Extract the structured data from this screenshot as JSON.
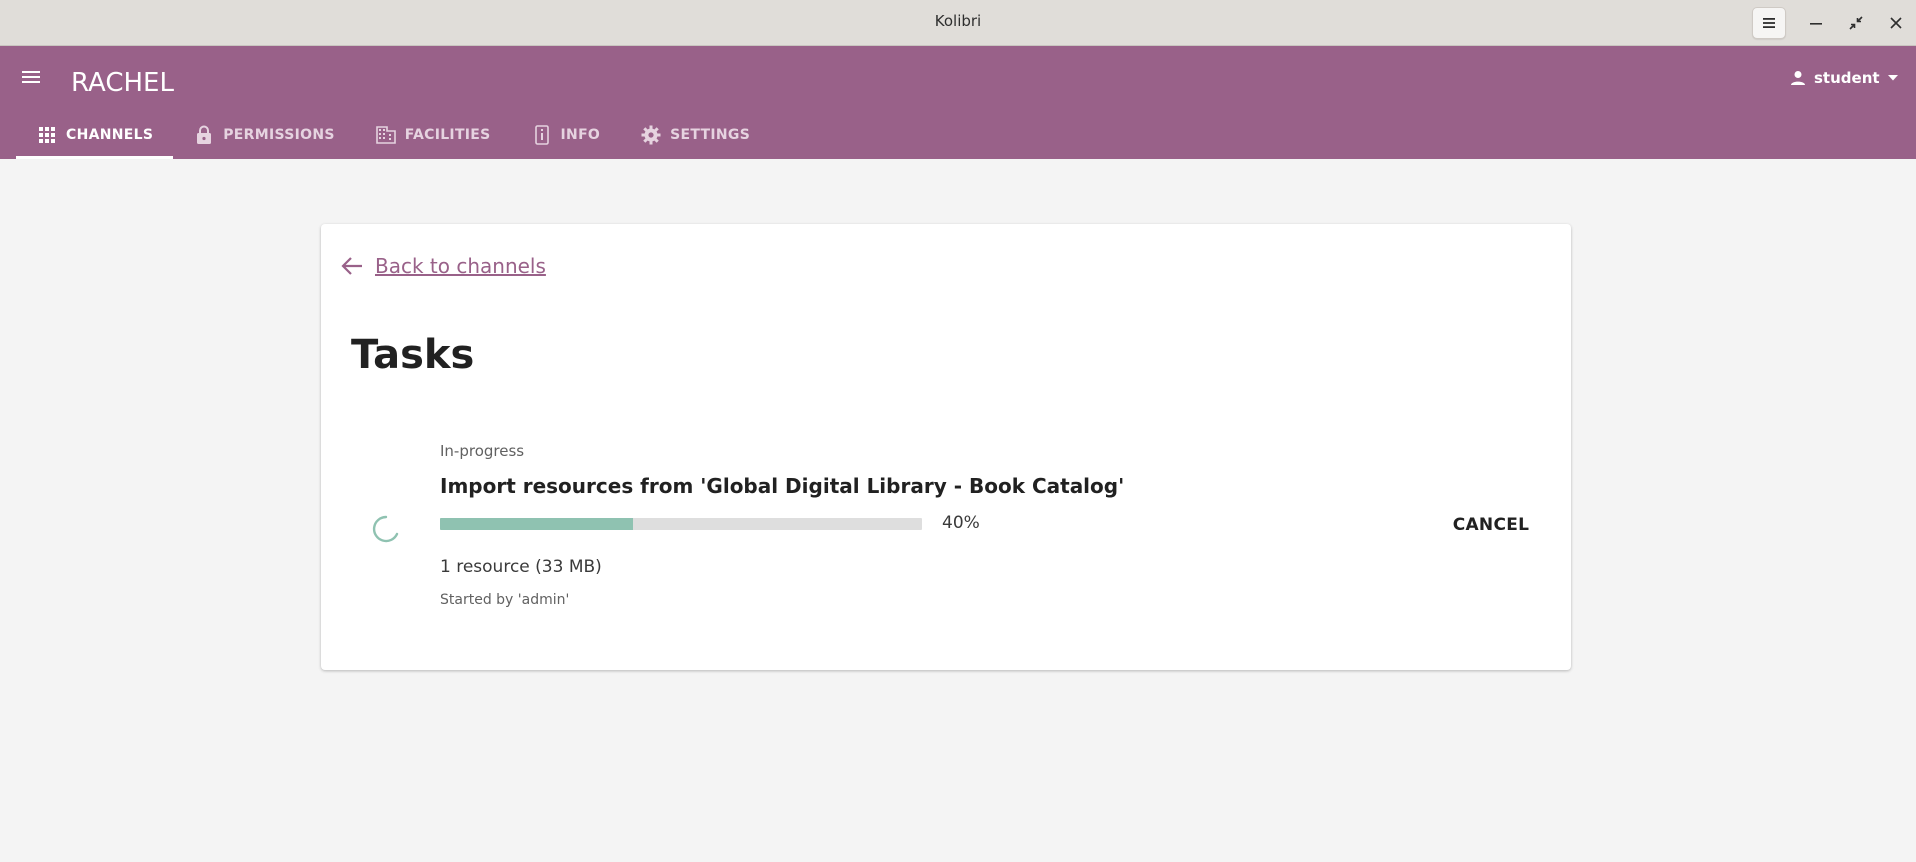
{
  "window": {
    "title": "Kolibri",
    "menu_icon": "hamburger-icon",
    "minimize_icon": "minimize-icon",
    "restore_icon": "restore-icon",
    "close_icon": "close-icon"
  },
  "header": {
    "title": "RACHEL",
    "user_name": "student",
    "tabs": [
      {
        "label": "CHANNELS",
        "icon": "grid-icon",
        "active": true
      },
      {
        "label": "PERMISSIONS",
        "icon": "lock-icon",
        "active": false
      },
      {
        "label": "FACILITIES",
        "icon": "building-icon",
        "active": false
      },
      {
        "label": "INFO",
        "icon": "device-info-icon",
        "active": false
      },
      {
        "label": "SETTINGS",
        "icon": "gear-icon",
        "active": false
      }
    ]
  },
  "main": {
    "back_label": "Back to channels",
    "page_title": "Tasks",
    "task": {
      "status": "In-progress",
      "title": "Import resources from 'Global Digital Library - Book Catalog'",
      "progress": 0.4,
      "progress_label": "40%",
      "size_label": "1 resource (33 MB)",
      "started_by": "Started by 'admin'",
      "cancel_label": "CANCEL"
    }
  },
  "colors": {
    "brand": "#996189",
    "progress_fill": "#8fc2b1",
    "progress_track": "#dedede"
  }
}
